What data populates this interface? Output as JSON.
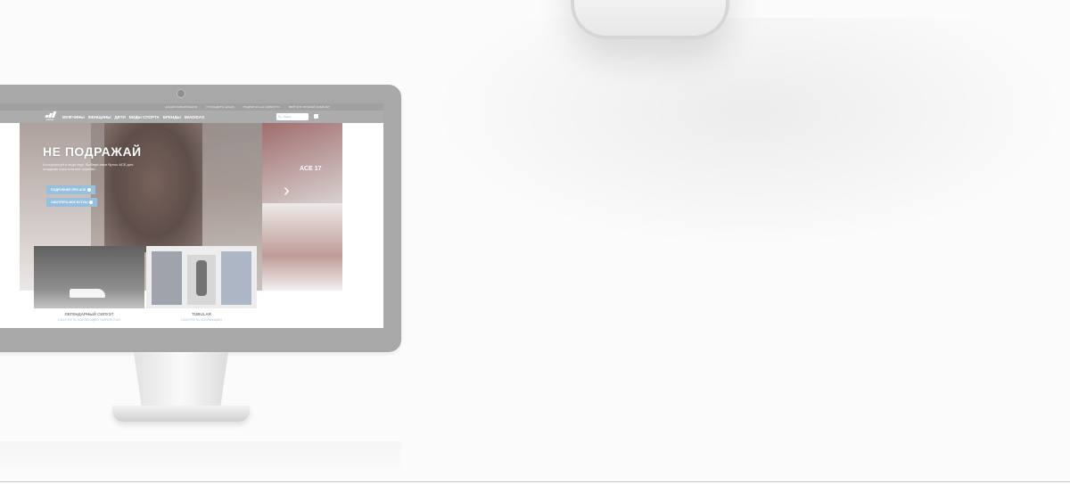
{
  "site": {
    "topbar_links": [
      "КАКАЯ ИНФОРМАЦИЯ",
      "ОТСЛЕДИТЬ ЗАКАЗ",
      "ПОДПИСКА НА НОВОСТИ",
      "ВОЙТИ В ЛИЧНЫЙ КАБИНЕТ"
    ],
    "logo_text": "adidas",
    "nav_items": [
      "МУЖЧИНЫ",
      "ЖЕНЩИНЫ",
      "ДЕТИ",
      "ВИДЫ СПОРТА",
      "БРЕНДЫ",
      "MIADIDAS"
    ],
    "search_placeholder": "Поиск",
    "hero": {
      "title": "НЕ ПОДРАЖАЙ",
      "subtitle": "Контролируй и веди игру. Выбери свои бутсы ACE для создания игры или вне коробки.",
      "badge": "ACE 17",
      "button_primary": "ПОДРОБНЕЕ ПРО ACE",
      "button_secondary": "СМОТРЕТЬ ВСЕ БУТСЫ"
    },
    "promos": [
      {
        "title": "ЛЕГЕНДАРНЫЙ СИЛУЭТ",
        "link": "СМОТРЕТЬ КОЛЛЕКЦИЮ SUPERSTAR"
      },
      {
        "title": "TUBULAR",
        "link": "СМОТРЕТЬ КОЛЛЕКЦИЮ"
      }
    ]
  },
  "colors": {
    "accent_button": "#7fb2d6",
    "nav_bg": "#9a9a9a",
    "monitor_frame": "#a8a8a8"
  }
}
